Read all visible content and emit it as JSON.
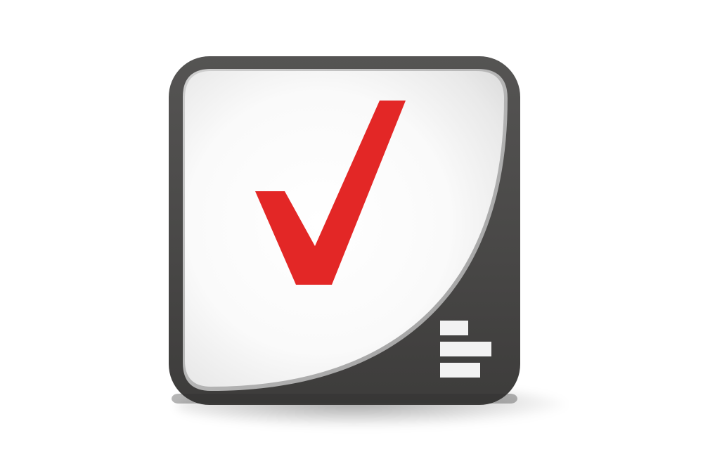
{
  "app_icon": {
    "semantic": "app-icon",
    "frame_color": "#4a4948",
    "face_color": "#f7f7f7",
    "check_color": "#e32726",
    "bars_color": "#f2f2f2",
    "check_icon": "checkmark-icon",
    "bars_icon": "stacked-bars-icon"
  }
}
